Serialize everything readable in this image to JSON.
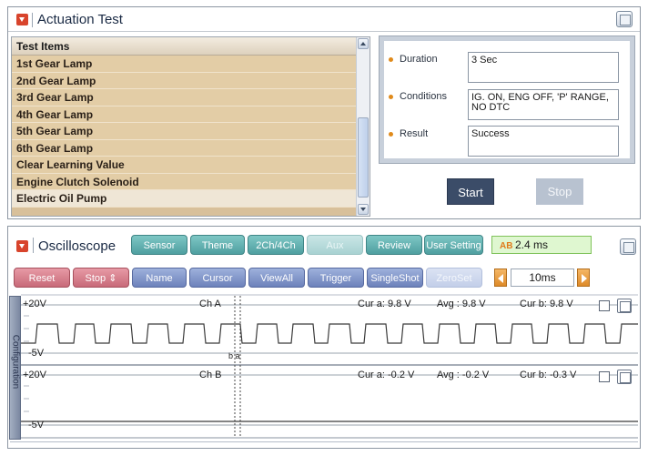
{
  "actuation": {
    "title": "Actuation Test",
    "list_header": "Test Items",
    "items": [
      "1st Gear Lamp",
      "2nd Gear Lamp",
      "3rd Gear Lamp",
      "4th Gear Lamp",
      "5th Gear Lamp",
      "6th Gear Lamp",
      "Clear Learning Value",
      "Engine Clutch Solenoid",
      "Electric Oil Pump"
    ],
    "duration_label": "Duration",
    "duration_value": "3 Sec",
    "conditions_label": "Conditions",
    "conditions_value": "IG. ON, ENG OFF, 'P' RANGE, NO DTC",
    "result_label": "Result",
    "result_value": "Success",
    "start_label": "Start",
    "stop_label": "Stop"
  },
  "oscilloscope": {
    "title": "Oscilloscope",
    "top_buttons": [
      "Sensor",
      "Theme",
      "2Ch/4Ch",
      "Aux",
      "Review",
      "User Setting"
    ],
    "time_value": "2.4 ms",
    "time_icon": "AB",
    "second_buttons": [
      "Reset",
      "Stop",
      "Name",
      "Cursor",
      "ViewAll",
      "Trigger",
      "SingleShot",
      "ZeroSet"
    ],
    "zoom_value": "10ms",
    "side_tab": "Configuration",
    "channels": [
      {
        "name": "Ch A",
        "vmax": "+20V",
        "vmin": "-5V",
        "cur_a": "Cur a: 9.8 V",
        "avg": "Avg : 9.8 V",
        "cur_b": "Cur b: 9.8 V",
        "cursor_label": "b a"
      },
      {
        "name": "Ch B",
        "vmax": "+20V",
        "vmin": "-5V",
        "cur_a": "Cur a: -0.2 V",
        "avg": "Avg : -0.2 V",
        "cur_b": "Cur b: -0.3 V"
      }
    ],
    "colors": {
      "teal": "#5aa9a8",
      "pink": "#d07b89",
      "blue": "#7f93c8",
      "time_bg": "#dff7d0"
    }
  }
}
